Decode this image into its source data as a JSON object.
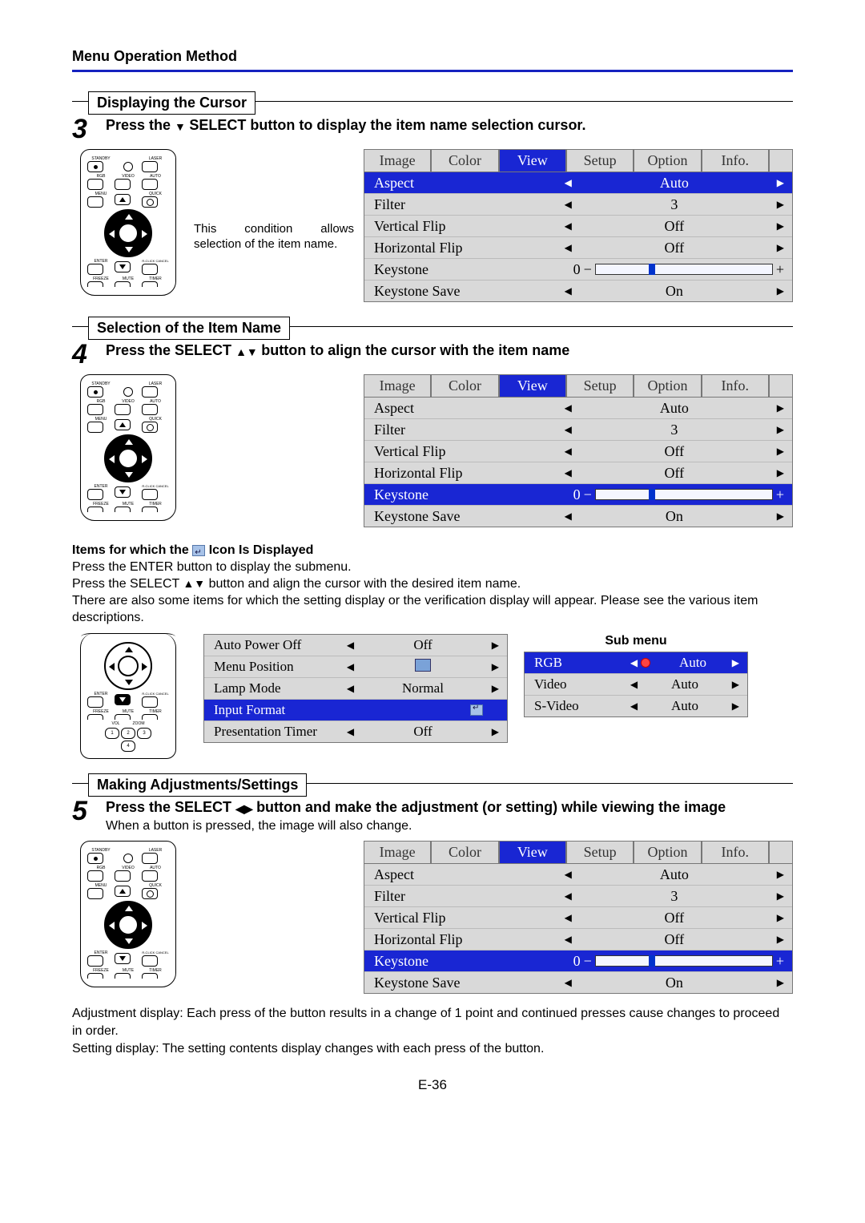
{
  "page": {
    "header": "Menu Operation Method",
    "footer": "E-36"
  },
  "step3": {
    "number": "3",
    "label": "Displaying the Cursor",
    "instruction_a": "Press the ",
    "instruction_b": " SELECT button to display the item name selection cursor.",
    "note": "This condition allows selection of the item name.",
    "menu": {
      "tabs": [
        "Image",
        "Color",
        "View",
        "Setup",
        "Option",
        "Info."
      ],
      "activeTab": "View",
      "rows": [
        {
          "name": "Aspect",
          "type": "val",
          "value": "Auto",
          "sel": true
        },
        {
          "name": "Filter",
          "type": "val",
          "value": "3"
        },
        {
          "name": "Vertical Flip",
          "type": "val",
          "value": "Off"
        },
        {
          "name": "Horizontal Flip",
          "type": "val",
          "value": "Off"
        },
        {
          "name": "Keystone",
          "type": "slider",
          "value": "0"
        },
        {
          "name": "Keystone Save",
          "type": "val",
          "value": "On"
        }
      ]
    }
  },
  "step4": {
    "number": "4",
    "label": "Selection of the Item Name",
    "instruction_a": "Press the SELECT ",
    "instruction_b": " button to align the cursor with the item name",
    "menu": {
      "tabs": [
        "Image",
        "Color",
        "View",
        "Setup",
        "Option",
        "Info."
      ],
      "activeTab": "View",
      "rows": [
        {
          "name": "Aspect",
          "type": "val",
          "value": "Auto"
        },
        {
          "name": "Filter",
          "type": "val",
          "value": "3"
        },
        {
          "name": "Vertical Flip",
          "type": "val",
          "value": "Off"
        },
        {
          "name": "Horizontal Flip",
          "type": "val",
          "value": "Off"
        },
        {
          "name": "Keystone",
          "type": "slider",
          "value": "0",
          "sel": true
        },
        {
          "name": "Keystone Save",
          "type": "val",
          "value": "On"
        }
      ]
    }
  },
  "submenu_note": {
    "title_a": "Items for which the ",
    "title_b": " Icon Is Displayed",
    "line1": "Press the ENTER button to display the submenu.",
    "line2_a": "Press the SELECT ",
    "line2_b": " button and align the cursor with the desired item name.",
    "line3": "There are also some items for which the setting display or the verification display will appear. Please see the various item descriptions.",
    "submenu_label": "Sub menu",
    "left_menu": {
      "rows": [
        {
          "name": "Auto Power Off",
          "type": "val",
          "value": "Off"
        },
        {
          "name": "Menu Position",
          "type": "icon",
          "value": "pos"
        },
        {
          "name": "Lamp Mode",
          "type": "val",
          "value": "Normal"
        },
        {
          "name": "Input Format",
          "type": "enter",
          "sel": true
        },
        {
          "name": "Presentation Timer",
          "type": "val",
          "value": "Off"
        }
      ]
    },
    "right_menu": {
      "rows": [
        {
          "name": "RGB",
          "type": "radio",
          "value": "Auto",
          "sel": true
        },
        {
          "name": "Video",
          "type": "val",
          "value": "Auto"
        },
        {
          "name": "S-Video",
          "type": "val",
          "value": "Auto"
        }
      ]
    }
  },
  "step5": {
    "number": "5",
    "label": "Making Adjustments/Settings",
    "instruction_a": "Press the SELECT ",
    "instruction_b": " button and make the adjustment (or setting) while viewing the image",
    "sub": "When a button is pressed, the image will also change.",
    "menu": {
      "tabs": [
        "Image",
        "Color",
        "View",
        "Setup",
        "Option",
        "Info."
      ],
      "activeTab": "View",
      "rows": [
        {
          "name": "Aspect",
          "type": "val",
          "value": "Auto"
        },
        {
          "name": "Filter",
          "type": "val",
          "value": "3"
        },
        {
          "name": "Vertical Flip",
          "type": "val",
          "value": "Off"
        },
        {
          "name": "Horizontal Flip",
          "type": "val",
          "value": "Off"
        },
        {
          "name": "Keystone",
          "type": "slider",
          "value": "0",
          "sel": true
        },
        {
          "name": "Keystone Save",
          "type": "val",
          "value": "On"
        }
      ]
    },
    "desc1": "Adjustment display: Each press of the button results in a change of 1 point and continued presses cause changes to proceed in order.",
    "desc2": "Setting display: The setting contents display changes with each press of the button."
  },
  "remote": {
    "top_labels": [
      "STANDBY",
      "",
      "LASER"
    ],
    "row2_labels": [
      "RGB",
      "VIDEO",
      "AUTO"
    ],
    "row3_labels": [
      "MENU",
      "",
      "QUICK"
    ],
    "enter_label": "ENTER",
    "rclick_label": "R-CLICK CANCEL",
    "bottom_labels": [
      "FREEZE",
      "MUTE",
      "TIMER"
    ],
    "vol_label": "VOL",
    "zoom_label": "ZOOM",
    "nums": [
      "1",
      "2",
      "3",
      "4"
    ]
  }
}
